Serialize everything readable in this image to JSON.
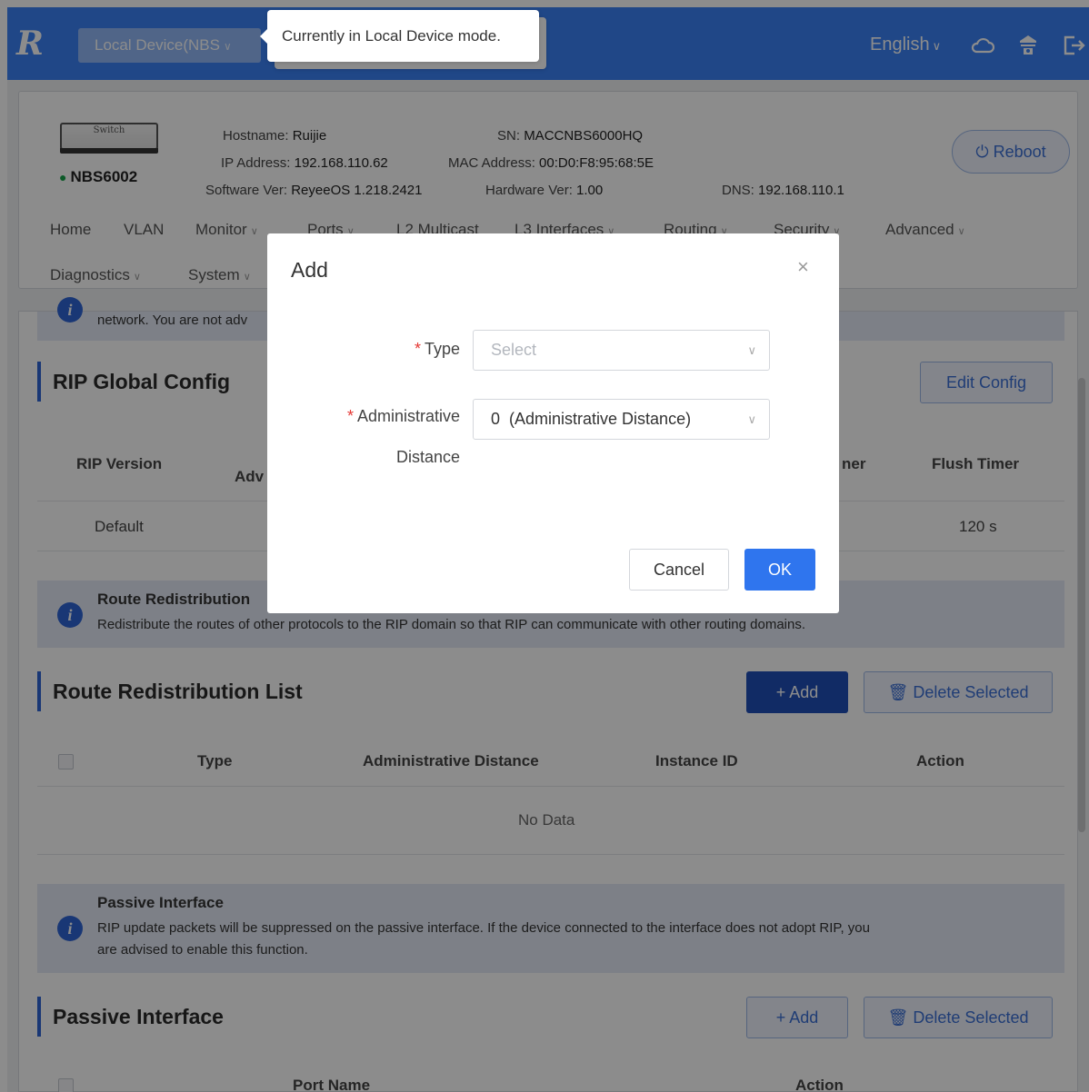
{
  "header": {
    "logo": "R",
    "device_select": "Local Device(NBS",
    "tooltip": "Currently in Local Device mode.",
    "language": "English"
  },
  "device": {
    "switch_label": "Switch",
    "model": "NBS6002",
    "hostname_label": "Hostname:",
    "hostname": "Ruijie",
    "sn_label": "SN:",
    "sn": "MACCNBS6000HQ",
    "ip_label": "IP Address:",
    "ip": "192.168.110.62",
    "mac_label": "MAC Address:",
    "mac": "00:D0:F8:95:68:5E",
    "software_label": "Software Ver:",
    "software": "ReyeeOS 1.218.2421",
    "hardware_label": "Hardware Ver:",
    "hardware": "1.00",
    "dns_label": "DNS:",
    "dns": "192.168.110.1",
    "reboot": "Reboot"
  },
  "nav": {
    "home": "Home",
    "vlan": "VLAN",
    "monitor": "Monitor",
    "ports": "Ports",
    "l2_multicast": "L2 Multicast",
    "l3_interfaces": "L3 Interfaces",
    "routing": "Routing",
    "security": "Security",
    "advanced": "Advanced",
    "diagnostics": "Diagnostics",
    "system": "System"
  },
  "top_alert": {
    "text": "network. You are not adv"
  },
  "rip_global": {
    "title": "RIP Global Config",
    "edit": "Edit Config",
    "columns": {
      "version": "RIP Version",
      "adv": "Adv",
      "timer": "ner",
      "flush": "Flush Timer"
    },
    "row": {
      "version": "Default",
      "flush": "120 s"
    }
  },
  "route_redistribution_alert": {
    "title": "Route Redistribution",
    "desc": "Redistribute the routes of other protocols to the RIP domain so that RIP can communicate with other routing domains."
  },
  "route_list": {
    "title": "Route Redistribution List",
    "add": "+ Add",
    "delete": "Delete Selected",
    "columns": [
      "Type",
      "Administrative Distance",
      "Instance ID",
      "Action"
    ],
    "empty": "No Data"
  },
  "passive_alert": {
    "title": "Passive Interface",
    "desc1": "RIP update packets will be suppressed on the passive interface. If the device connected to the interface does not adopt RIP, you",
    "desc2": "are advised to enable this function."
  },
  "passive": {
    "title": "Passive Interface",
    "add": "+ Add",
    "delete": "Delete Selected",
    "columns": [
      "Port Name",
      "Action"
    ]
  },
  "modal": {
    "title": "Add",
    "close": "×",
    "type_label": "Type",
    "type_placeholder": "Select",
    "ad_label_1": "Administrative",
    "ad_label_2": "Distance",
    "ad_value": "0  (Administrative Distance)",
    "cancel": "Cancel",
    "ok": "OK"
  },
  "colors": {
    "brand": "#3b82f6",
    "primary": "#1f4fb8",
    "status_online": "#16a34a",
    "required": "#e53935"
  }
}
